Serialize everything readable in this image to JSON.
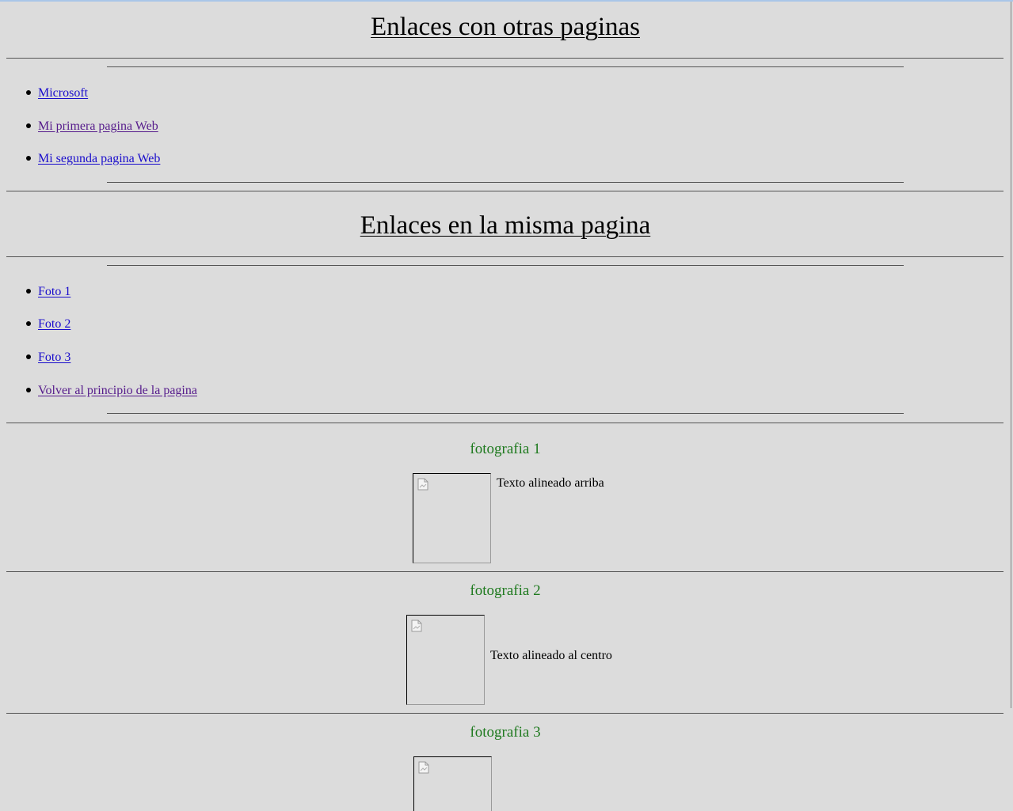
{
  "sections": {
    "external": {
      "title": "Enlaces con otras paginas",
      "links": [
        {
          "label": "Microsoft",
          "visited": false
        },
        {
          "label": "Mi primera pagina Web",
          "visited": true
        },
        {
          "label": "Mi segunda pagina Web",
          "visited": false
        }
      ]
    },
    "internal": {
      "title": "Enlaces en la misma pagina",
      "links": [
        {
          "label": "Foto 1",
          "visited": false
        },
        {
          "label": "Foto 2",
          "visited": false
        },
        {
          "label": "Foto 3",
          "visited": false
        },
        {
          "label": "Volver al principio de la pagina",
          "visited": true
        }
      ]
    }
  },
  "photos": [
    {
      "caption": "fotografia 1",
      "text": "Texto alineado arriba"
    },
    {
      "caption": "fotografia 2",
      "text": "Texto alineado al centro"
    },
    {
      "caption": "fotografia 3",
      "text": ""
    }
  ],
  "colors": {
    "background": "#dcdcdc",
    "link_unvisited": "#1a0dcc",
    "link_visited": "#551a8b",
    "caption": "#1f7a1f"
  },
  "icons": {
    "broken_image": "broken-image-icon"
  }
}
